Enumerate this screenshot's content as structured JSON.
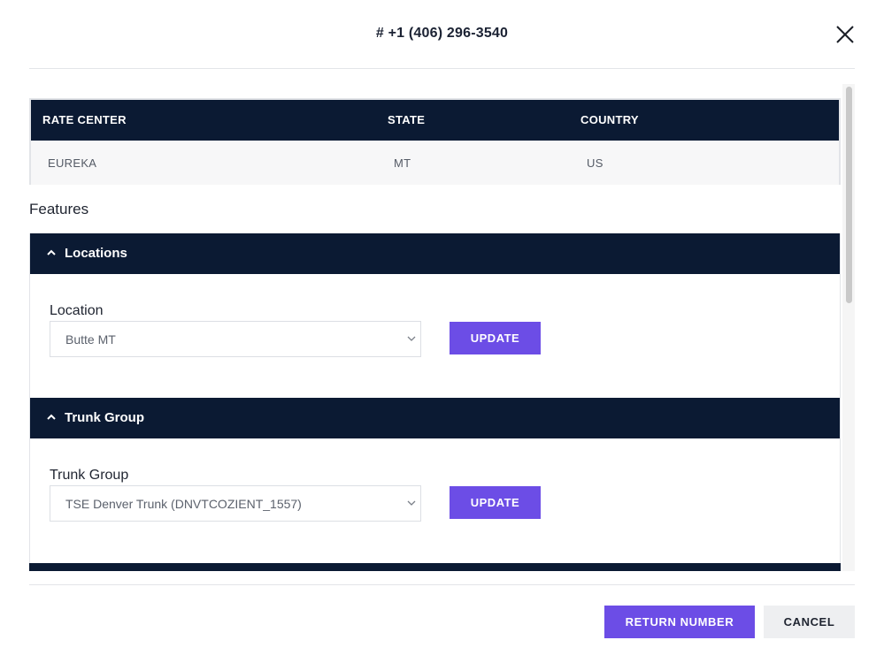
{
  "modal": {
    "title": "# +1 (406) 296-3540",
    "close_icon": "close-icon"
  },
  "rate_table": {
    "columns": [
      "RATE CENTER",
      "STATE",
      "COUNTRY"
    ],
    "rows": [
      [
        "EUREKA",
        "MT",
        "US"
      ]
    ]
  },
  "features": {
    "label": "Features",
    "sections": [
      {
        "title": "Locations",
        "icon": "chevron-up-icon",
        "field_label": "Location",
        "selected": "Butte MT",
        "button": "UPDATE"
      },
      {
        "title": "Trunk Group",
        "icon": "chevron-up-icon",
        "field_label": "Trunk Group",
        "selected": "TSE Denver Trunk (DNVTCOZIENT_1557)",
        "button": "UPDATE"
      }
    ]
  },
  "footer": {
    "return_label": "RETURN NUMBER",
    "cancel_label": "CANCEL"
  },
  "colors": {
    "header_bg": "#0b1a33",
    "accent": "#6c4de6",
    "cancel_bg": "#eeeff1"
  }
}
